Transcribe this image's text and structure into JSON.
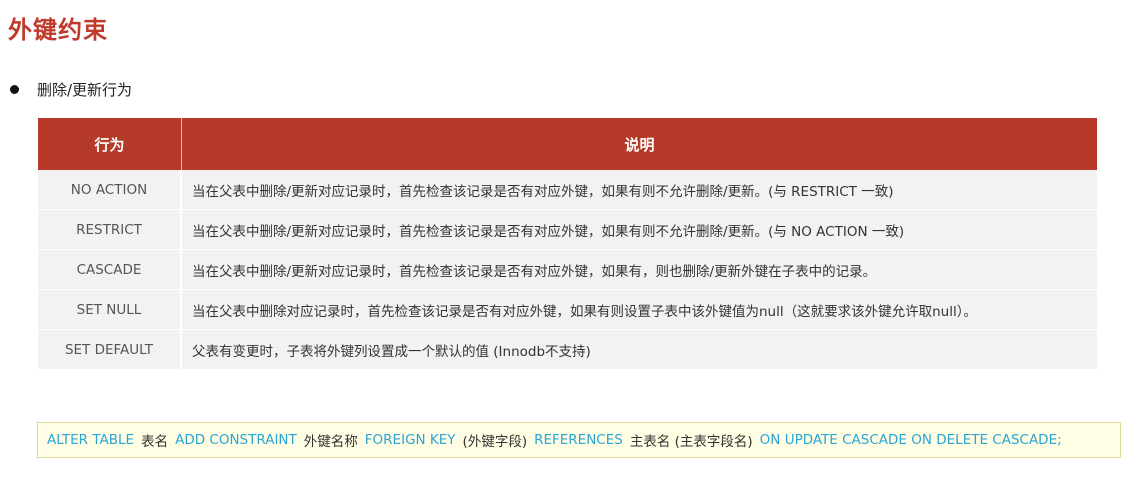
{
  "page": {
    "title": "外键约束",
    "bullet": "删除/更新行为"
  },
  "table": {
    "headers": [
      "行为",
      "说明"
    ],
    "rows": [
      {
        "behavior": "NO ACTION",
        "description": "当在父表中删除/更新对应记录时，首先检查该记录是否有对应外键，如果有则不允许删除/更新。(与 RESTRICT 一致)"
      },
      {
        "behavior": "RESTRICT",
        "description": "当在父表中删除/更新对应记录时，首先检查该记录是否有对应外键，如果有则不允许删除/更新。(与 NO ACTION 一致)"
      },
      {
        "behavior": "CASCADE",
        "description": "当在父表中删除/更新对应记录时，首先检查该记录是否有对应外键，如果有，则也删除/更新外键在子表中的记录。"
      },
      {
        "behavior": "SET NULL",
        "description": "当在父表中删除对应记录时，首先检查该记录是否有对应外键，如果有则设置子表中该外键值为null（这就要求该外键允许取null）。"
      },
      {
        "behavior": "SET DEFAULT",
        "description": "父表有变更时，子表将外键列设置成一个默认的值 (Innodb不支持)"
      }
    ]
  },
  "code": {
    "kw_alter": "ALTER TABLE",
    "table_name": "表名",
    "kw_add": "ADD CONSTRAINT",
    "fk_name": "外键名称",
    "kw_foreign": "FOREIGN KEY",
    "fk_field": "(外键字段)",
    "kw_references": "REFERENCES",
    "main_table": "主表名 (主表字段名)",
    "kw_on": "ON UPDATE CASCADE ON DELETE CASCADE;"
  },
  "colors": {
    "title": "#c0392b",
    "header_bg": "#b63a29",
    "row_bg": "#f2f2f2",
    "code_bg": "#fffde3",
    "keyword": "#2aa6d6"
  }
}
